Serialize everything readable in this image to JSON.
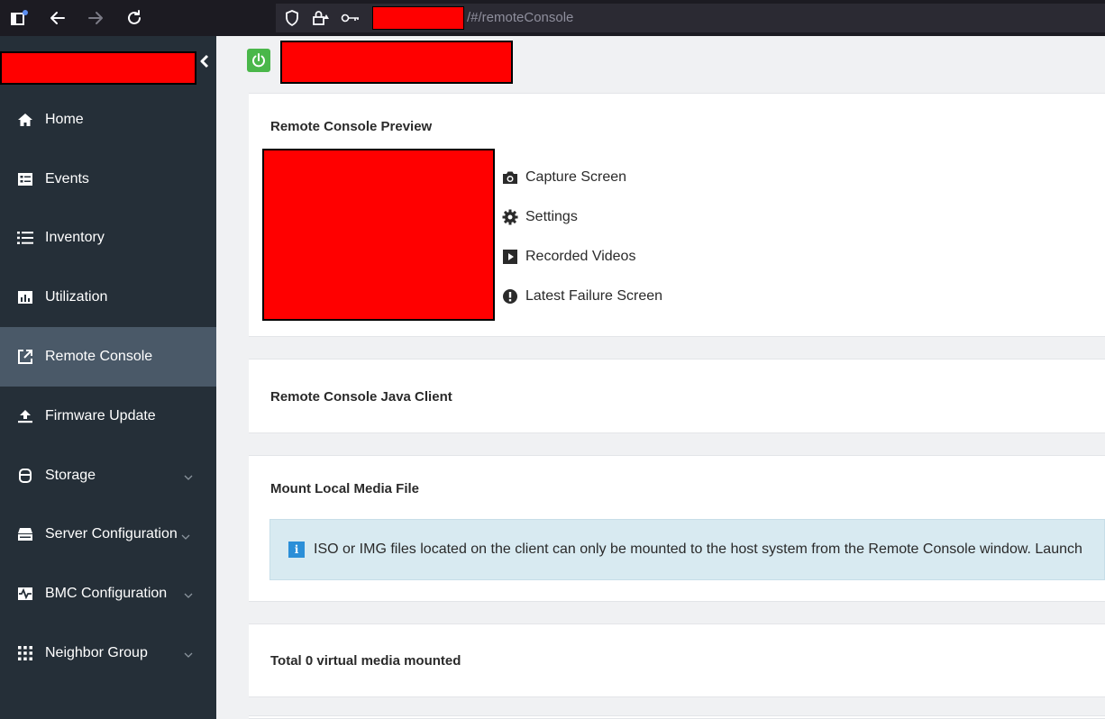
{
  "browser": {
    "url_path": "/#/remoteConsole",
    "icons": [
      "sidebar-icon",
      "back-icon",
      "forward-icon",
      "reload-icon",
      "shield-icon",
      "lock-icon",
      "key-icon"
    ]
  },
  "sidebar": {
    "items": [
      {
        "label": "Home",
        "icon": "home-icon"
      },
      {
        "label": "Events",
        "icon": "events-icon"
      },
      {
        "label": "Inventory",
        "icon": "list-icon"
      },
      {
        "label": "Utilization",
        "icon": "bar-chart-icon"
      },
      {
        "label": "Remote Console",
        "icon": "external-link-icon",
        "active": true
      },
      {
        "label": "Firmware Update",
        "icon": "upload-icon"
      },
      {
        "label": "Storage",
        "icon": "database-icon",
        "expandable": true
      },
      {
        "label": "Server Configuration",
        "icon": "server-icon",
        "expandable": true
      },
      {
        "label": "BMC Configuration",
        "icon": "pulse-icon",
        "expandable": true
      },
      {
        "label": "Neighbor Group",
        "icon": "grid-dots-icon",
        "expandable": true
      }
    ]
  },
  "main": {
    "preview_card": {
      "title": "Remote Console Preview",
      "actions": [
        {
          "label": "Capture Screen",
          "icon": "camera-icon"
        },
        {
          "label": "Settings",
          "icon": "gear-icon"
        },
        {
          "label": "Recorded Videos",
          "icon": "play-icon"
        },
        {
          "label": "Latest Failure Screen",
          "icon": "exclamation-icon"
        }
      ]
    },
    "java_card": {
      "title": "Remote Console Java Client"
    },
    "mount_card": {
      "title": "Mount Local Media File",
      "info": "ISO or IMG files located on the client can only be mounted to the host system from the Remote Console window. Launch"
    },
    "virtual_card": {
      "title": "Total 0 virtual media mounted"
    }
  },
  "colors": {
    "sidebar_bg": "#252f38",
    "sidebar_active": "#4a5968",
    "power_green": "#4ab74a",
    "info_bg": "#d8eaf1",
    "info_icon": "#2b8fd8",
    "redaction": "#ff0000"
  }
}
